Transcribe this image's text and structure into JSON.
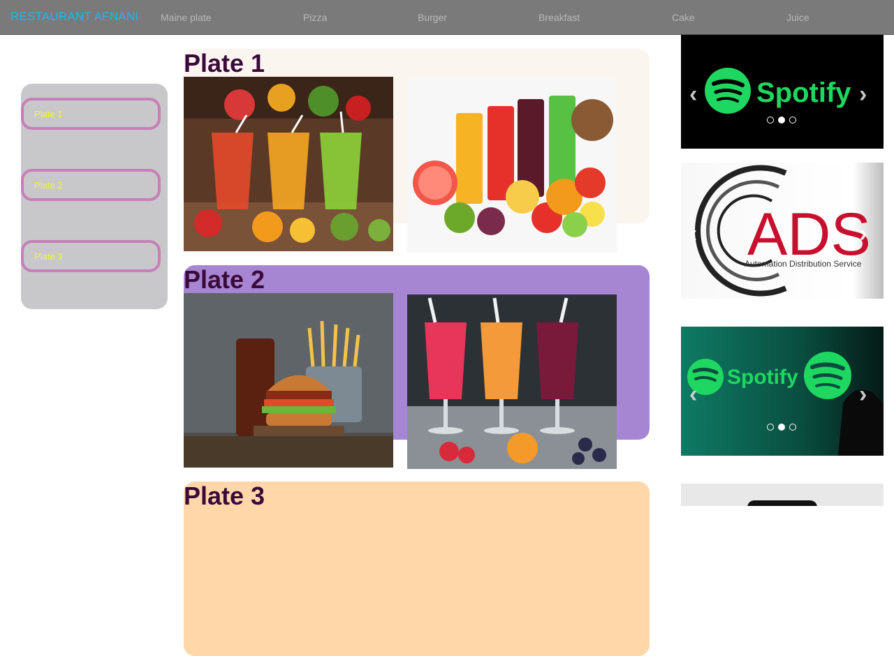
{
  "navbar": {
    "brand": "RESTAURANT AFNANI",
    "items": [
      "Maine plate",
      "Pizza",
      "Burger",
      "Breakfast",
      "Cake",
      "Juice"
    ]
  },
  "sidebar": {
    "items": [
      "Plate 1",
      "Plate 2",
      "Plate 3"
    ]
  },
  "plates": [
    {
      "title": "Plate 1",
      "bg_color": "#fbf5ef"
    },
    {
      "title": "Plate 2",
      "bg_color": "#a685d3"
    },
    {
      "title": "Plate 3",
      "bg_color": "#ffd7a8"
    }
  ],
  "ads": [
    {
      "text": "Spotify",
      "type": "spotify-logo"
    },
    {
      "text": "ADS",
      "subtext": "Automation Distribution Service",
      "type": "ads-logo"
    },
    {
      "text": "Spotify",
      "type": "spotify-banner"
    }
  ],
  "colors": {
    "navbar": "#7a7a7a",
    "brand": "#1fb6ec",
    "sidebar_button_border": "#c77fba",
    "sidebar_button_text": "#f5f53a",
    "spotify_green": "#1ed760",
    "ads_red": "#c8102e"
  }
}
